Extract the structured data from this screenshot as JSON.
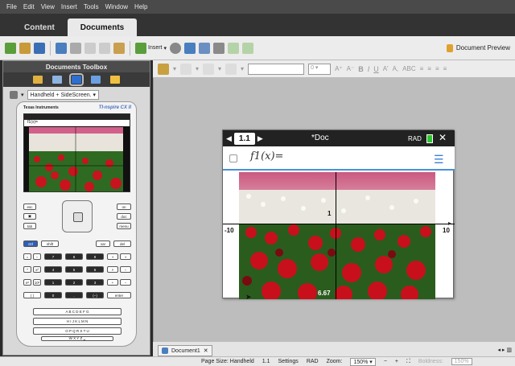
{
  "menu": [
    "File",
    "Edit",
    "View",
    "Insert",
    "Tools",
    "Window",
    "Help"
  ],
  "tabs": [
    "Content",
    "Documents"
  ],
  "toolbar": {
    "insert_label": "Insert",
    "doc_preview": "Document Preview"
  },
  "toolbox": {
    "title": "Documents Toolbox",
    "view_option": "Handheld + SideScreen.",
    "brand": "Texas Instruments",
    "model": "TI-nspire CX II",
    "mini_entry": "f1(x)="
  },
  "format": {
    "size": "0",
    "bold": "B",
    "italic": "I",
    "underline": "U"
  },
  "calc": {
    "tab": "1.1",
    "doc_title": "*Doc",
    "mode": "RAD",
    "entry": "f1(x)=",
    "xmin": "-10",
    "xmax": "10",
    "ymark": "1",
    "coord": "6.67"
  },
  "statusbar": {
    "doc_tab": "Document1",
    "page_size": "Page Size: Handheld",
    "page": "1.1",
    "settings": "Settings",
    "mode": "RAD",
    "zoom_label": "Zoom:",
    "zoom": "150%",
    "boldness_label": "Boldness:",
    "boldness": "150%"
  },
  "colors": {
    "accent": "#3a7fd5",
    "battery": "#2ec52e"
  }
}
